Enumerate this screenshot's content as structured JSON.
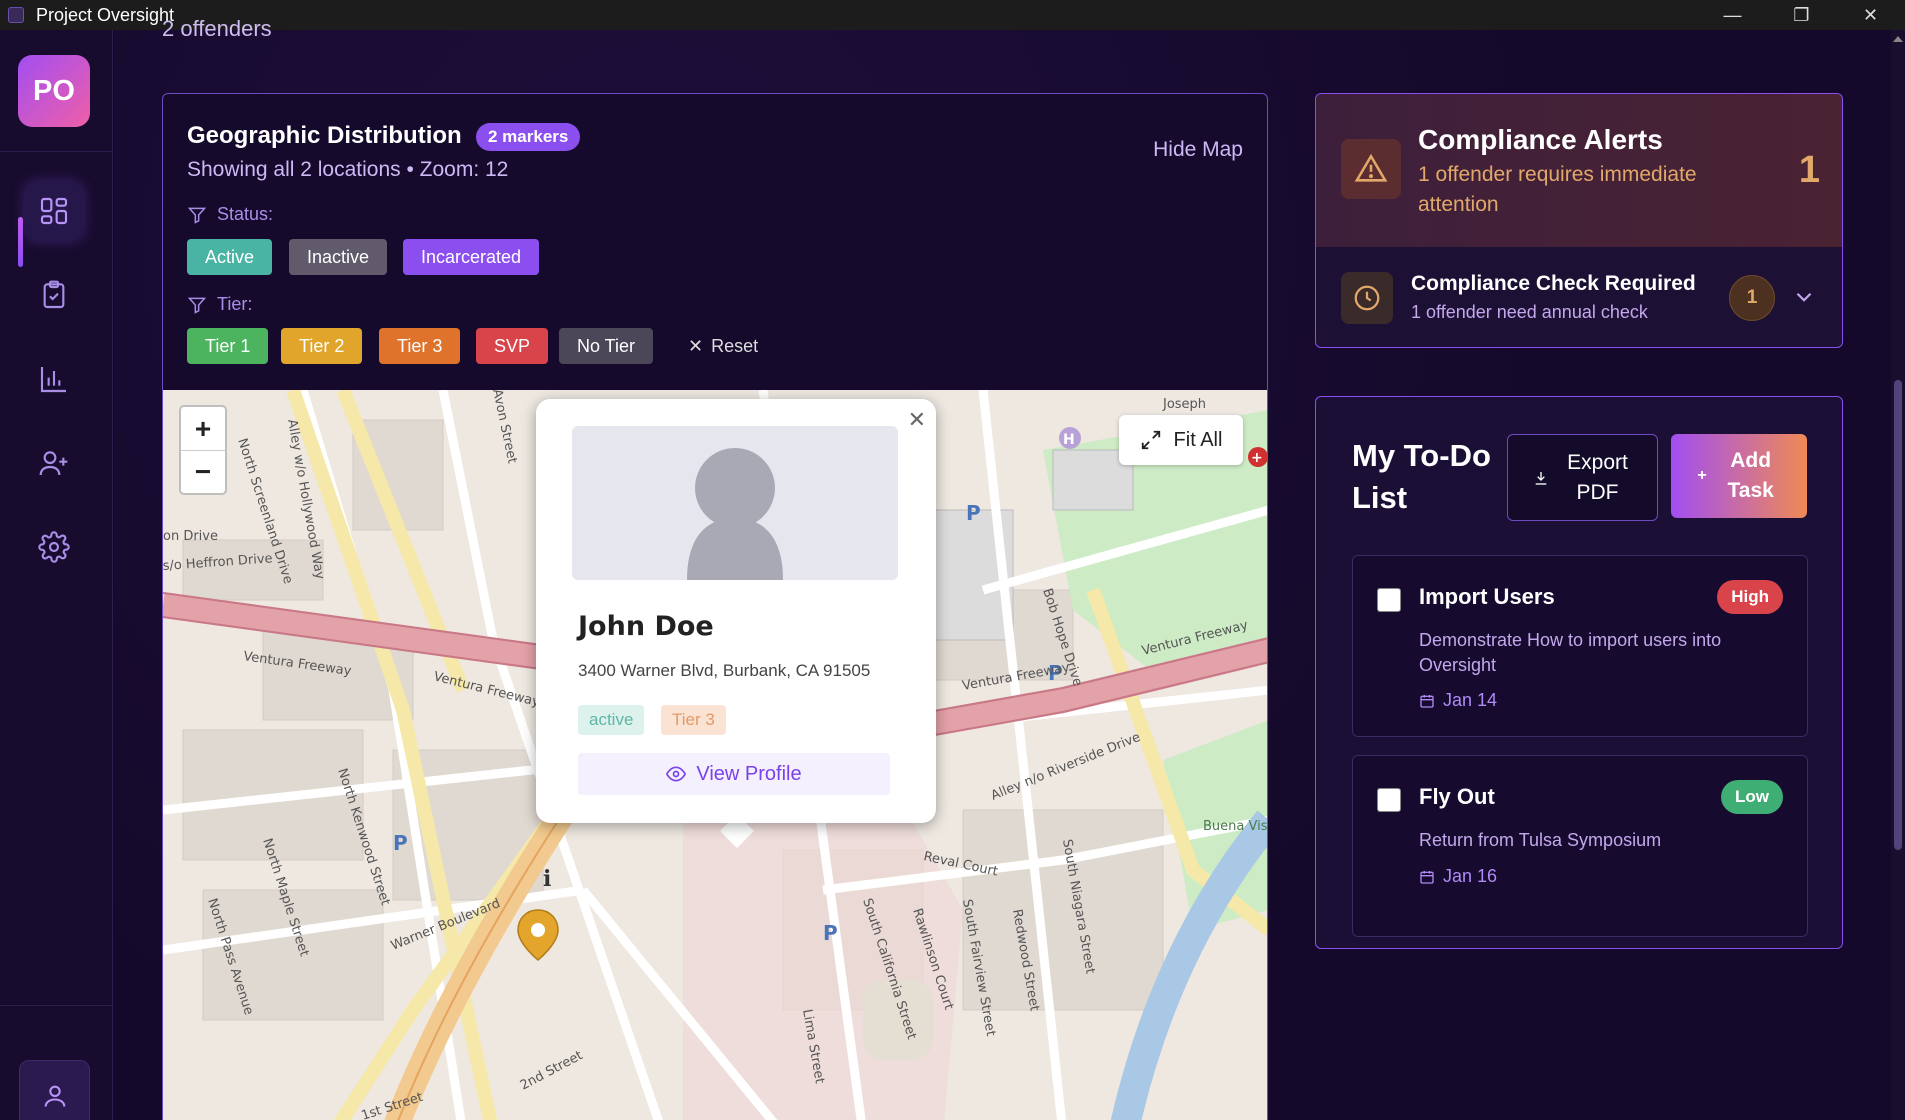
{
  "window": {
    "title": "Project Oversight",
    "minimize": "—",
    "maximize": "❐",
    "close": "✕"
  },
  "sidebar": {
    "logo": "PO",
    "items": [
      {
        "icon": "dashboard-icon",
        "active": true
      },
      {
        "icon": "clipboard-check-icon",
        "active": false
      },
      {
        "icon": "bar-chart-icon",
        "active": false
      },
      {
        "icon": "user-plus-icon",
        "active": false
      },
      {
        "icon": "gear-icon",
        "active": false
      }
    ],
    "bottom_icon": "user-icon"
  },
  "header": {
    "offenders_text": "2 offenders"
  },
  "map_card": {
    "title": "Geographic Distribution",
    "markers_badge": "2 markers",
    "subtitle": "Showing all 2 locations • Zoom: 12",
    "hide_map": "Hide Map",
    "status_label": "Status:",
    "status_chips": [
      {
        "label": "Active",
        "color": "#4ab4a4"
      },
      {
        "label": "Inactive",
        "color": "#605a6a"
      },
      {
        "label": "Incarcerated",
        "color": "#8b4ff0"
      }
    ],
    "tier_label": "Tier:",
    "tier_chips": [
      {
        "label": "Tier 1",
        "color": "#4cb35e"
      },
      {
        "label": "Tier 2",
        "color": "#e0a52a"
      },
      {
        "label": "Tier 3",
        "color": "#e0732c"
      },
      {
        "label": "SVP",
        "color": "#d9434a"
      },
      {
        "label": "No Tier",
        "color": "#4b4658"
      }
    ],
    "reset_label": "Reset",
    "zoom_in": "+",
    "zoom_out": "−",
    "fit_all": "Fit All",
    "street_labels": [
      "Ventura Freeway",
      "Ventura Freeway",
      "Ventura Freeway",
      "Ventura Freeway",
      "Warner Boulevard",
      "Reval Court",
      "South California Street",
      "South Niagara Street",
      "Alley n/o Riverside Drive",
      "Bob Hope Drive",
      "Alley w/o Hollywood Way",
      "North Screenland Drive",
      "Avon Street",
      "North Kenwood Street",
      "North Maple Street",
      "North Pass Avenue",
      "Lima Street",
      "2nd Street",
      "1st Street",
      "Redwood Street",
      "Rawlinson Court",
      "South Fairview Street",
      "Buena Vista Park",
      "Joseph",
      "s/o Heffron Drive",
      "on Drive"
    ],
    "popup": {
      "close": "✕",
      "name": "John Doe",
      "address": "3400 Warner Blvd, Burbank, CA 91505",
      "status_tag": "active",
      "tier_tag": "Tier 3",
      "view_profile": "View Profile"
    }
  },
  "alerts": {
    "title": "Compliance Alerts",
    "subtitle": "1 offender requires immediate attention",
    "count": "1",
    "check_title": "Compliance Check Required",
    "check_subtitle": "1 offender need annual check",
    "check_count": "1"
  },
  "todo": {
    "title": "My To-Do List",
    "export_label": "Export PDF",
    "add_label": "Add Task",
    "tasks": [
      {
        "title": "Import Users",
        "priority": "High",
        "priority_color": "#d9434a",
        "description": "Demonstrate How to import users into Oversight",
        "date": "Jan 14"
      },
      {
        "title": "Fly Out",
        "priority": "Low",
        "priority_color": "#3fae74",
        "description": "Return from Tulsa Symposium",
        "date": "Jan 16"
      }
    ]
  }
}
